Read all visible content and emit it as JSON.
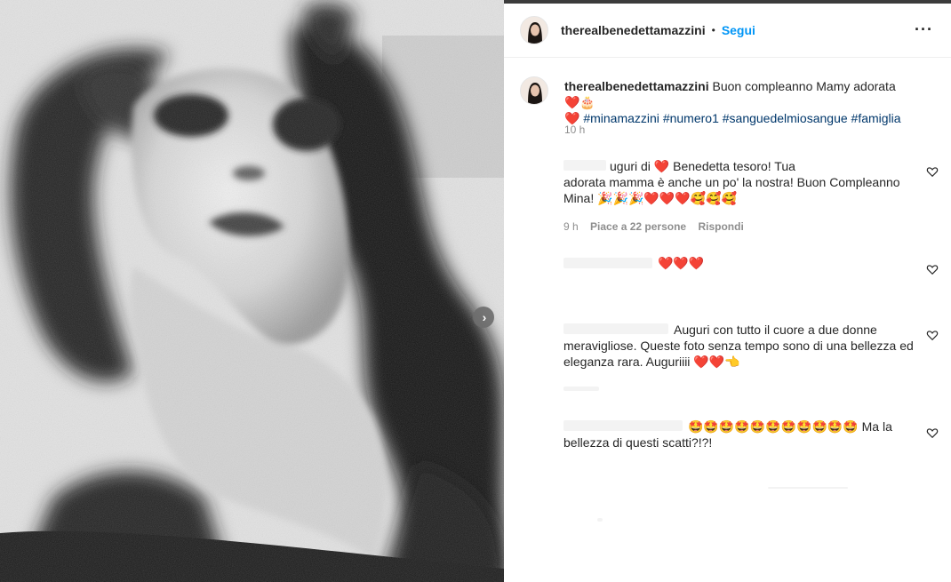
{
  "colors": {
    "accent": "#0095f6",
    "hashtag": "#00376b",
    "muted": "#8e8e8e",
    "heart": "#ed2a2a"
  },
  "header": {
    "username": "therealbenedettamazzini",
    "separator": "•",
    "follow_label": "Segui",
    "more_icon": "more-horizontal-icon",
    "more_glyph": "···"
  },
  "photo": {
    "next_glyph": "›"
  },
  "caption": {
    "username": "therealbenedettamazzini",
    "text": "Buon compleanno Mamy adorata",
    "emoji_after_text": "❤️🎂",
    "emoji_line2": "❤️",
    "hashtags": [
      "#minamazzini",
      "#numero1",
      "#sanguedelmiosangue",
      "#famiglia"
    ],
    "time": "10 h"
  },
  "comments": [
    {
      "line1_prefix": "uguri di",
      "line1_emoji": "❤️",
      "line1_rest": "Benedetta tesoro! Tua",
      "line2": "adorata mamma è anche un po' la nostra! Buon Compleanno",
      "line3": "Mina!",
      "line3_emoji": "🎉🎉🎉❤️❤️❤️🥰🥰🥰",
      "meta": {
        "time": "9 h",
        "likes": "Piace a 22 persone",
        "reply": "Rispondi"
      }
    },
    {
      "text": "",
      "emoji": "❤️❤️❤️"
    },
    {
      "line1": "Auguri con tutto il cuore a due donne",
      "line2": "meravigliose. Queste foto senza tempo sono di una bellezza ed",
      "line3": "eleganza rara. Auguriiii",
      "line3_emoji": "❤️❤️👈"
    },
    {
      "line1_emoji": "🤩🤩🤩🤩🤩🤩🤩🤩🤩🤩🤩",
      "line1_rest": "Ma la",
      "line2": "bellezza di questi scatti?!?!"
    }
  ]
}
